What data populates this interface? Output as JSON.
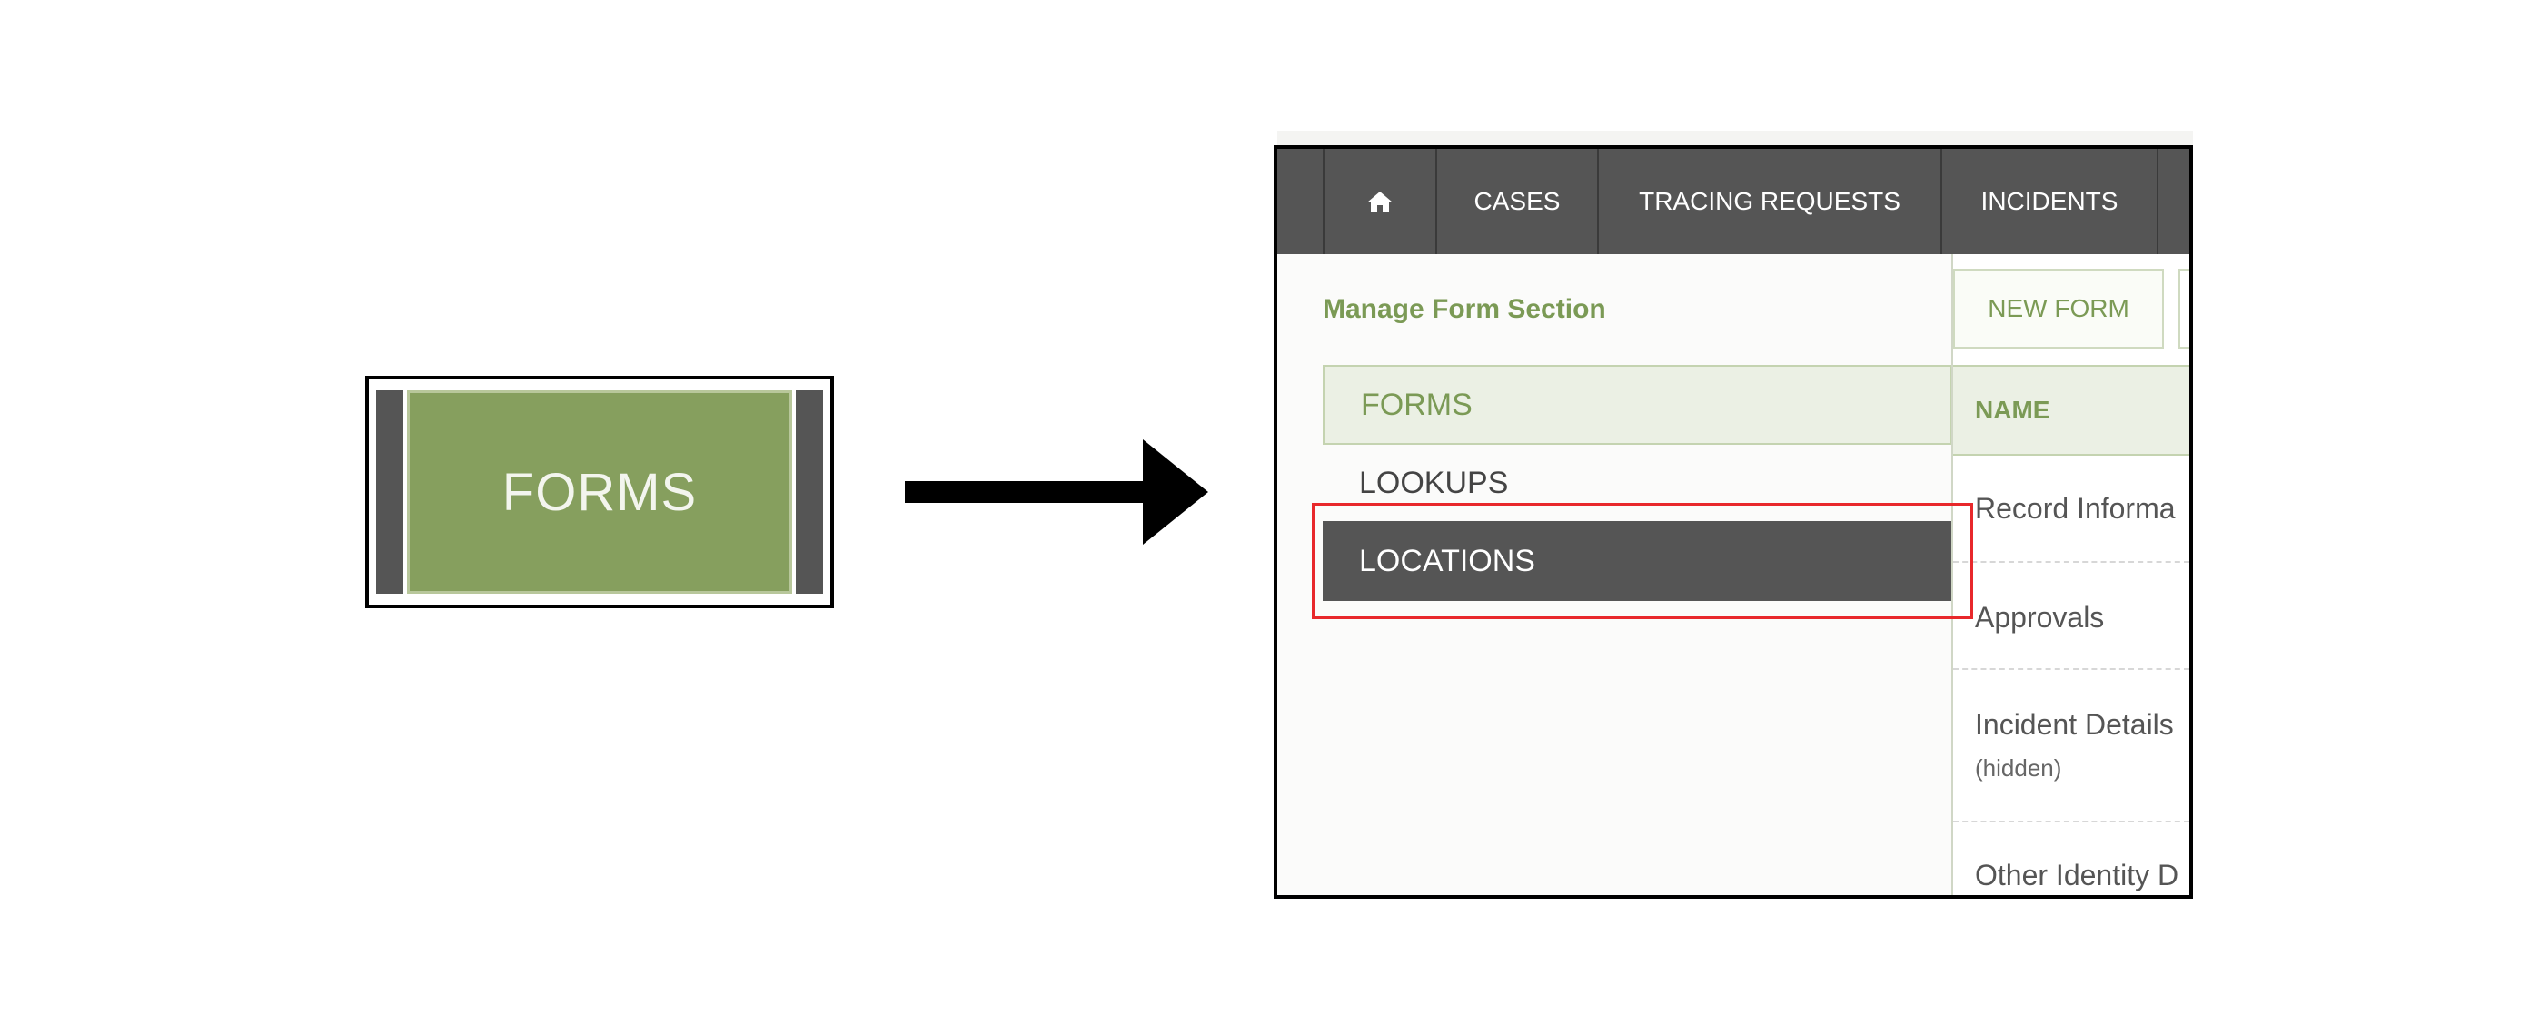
{
  "callout": {
    "button_label": "FORMS"
  },
  "topnav": {
    "home_icon": "home-icon",
    "items": [
      "CASES",
      "TRACING REQUESTS",
      "INCIDENTS"
    ]
  },
  "page": {
    "title": "Manage Form Section"
  },
  "sidebar": {
    "items": [
      {
        "label": "FORMS",
        "state": "active"
      },
      {
        "label": "LOOKUPS",
        "state": "default"
      },
      {
        "label": "LOCATIONS",
        "state": "highlighted"
      }
    ]
  },
  "toolbar": {
    "new_form_label": "NEW FORM"
  },
  "table": {
    "header": "NAME",
    "rows": [
      {
        "name": "Record Informa",
        "note": ""
      },
      {
        "name": "Approvals",
        "note": ""
      },
      {
        "name": "Incident Details",
        "note": "(hidden)"
      },
      {
        "name": "Other Identity D",
        "note": ""
      }
    ]
  },
  "colors": {
    "accent_green": "#7b9a55",
    "forms_button": "#869f5e",
    "nav_dark": "#555555",
    "highlight_red": "#e8282b"
  }
}
